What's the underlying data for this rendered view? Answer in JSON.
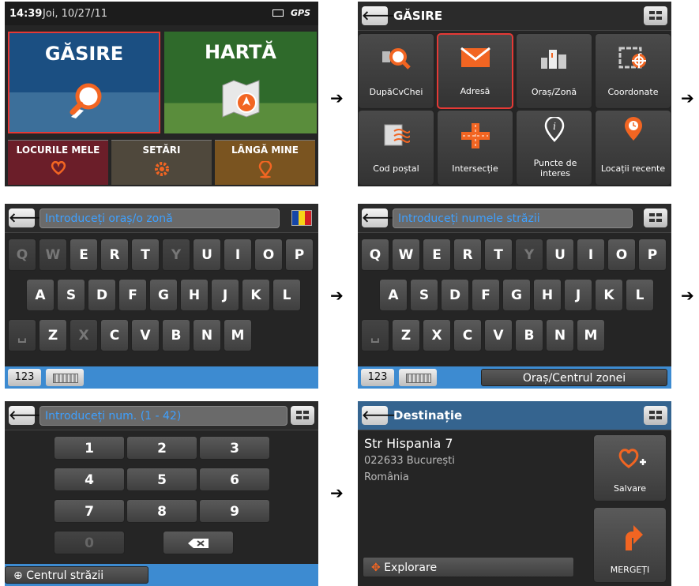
{
  "panel1": {
    "time": "14:39",
    "date": "Joi, 10/27/11",
    "gps": "GPS",
    "find_label": "GĂSIRE",
    "map_label": "HARTĂ",
    "my_places_label": "LOCURILE MELE",
    "settings_label": "SETĂRI",
    "near_me_label": "LÂNGĂ MINE"
  },
  "panel2": {
    "title": "GĂSIRE",
    "categories": [
      {
        "label": "DupăCvChei",
        "icon": "search-icon"
      },
      {
        "label": "Adresă",
        "icon": "envelope-icon",
        "selected": true
      },
      {
        "label": "Oraș/Zonă",
        "icon": "city-icon"
      },
      {
        "label": "Coordonate",
        "icon": "crosshair-icon"
      },
      {
        "label": "Cod poștal",
        "icon": "postal-icon"
      },
      {
        "label": "Intersecție",
        "icon": "intersection-icon"
      },
      {
        "label": "Puncte de interes",
        "icon": "info-pin-icon"
      },
      {
        "label": "Locații recente",
        "icon": "clock-pin-icon"
      }
    ]
  },
  "panel3": {
    "placeholder": "Introduceți oraș/o zonă",
    "row1": [
      "Q",
      "W",
      "E",
      "R",
      "T",
      "Y",
      "U",
      "I",
      "O",
      "P"
    ],
    "row2": [
      "A",
      "S",
      "D",
      "F",
      "G",
      "H",
      "J",
      "K",
      "L"
    ],
    "row3": [
      "␣",
      "Z",
      "X",
      "C",
      "V",
      "B",
      "N",
      "M"
    ],
    "num_label": "123"
  },
  "panel4": {
    "placeholder": "Introduceți numele străzii",
    "row1": [
      "Q",
      "W",
      "E",
      "R",
      "T",
      "Y",
      "U",
      "I",
      "O",
      "P"
    ],
    "row2": [
      "A",
      "S",
      "D",
      "F",
      "G",
      "H",
      "J",
      "K",
      "L"
    ],
    "row3": [
      "␣",
      "Z",
      "X",
      "C",
      "V",
      "B",
      "N",
      "M"
    ],
    "num_label": "123",
    "city_center_label": "Oraș/Centrul zonei"
  },
  "panel5": {
    "placeholder": "Introduceți num. (1 - 42)",
    "keys": [
      "1",
      "2",
      "3",
      "4",
      "5",
      "6",
      "7",
      "8",
      "9",
      "0"
    ],
    "street_center_label": "Centrul străzii"
  },
  "panel6": {
    "title": "Destinație",
    "street": "Str Hispania 7",
    "postal_city": "022633 București",
    "country": "România",
    "save_label": "Salvare",
    "go_label": "MERGEȚI",
    "explore_label": "Explorare"
  },
  "colors": {
    "accent_blue": "#3d8bd1",
    "select_red": "#e53935",
    "icon_orange": "#f26522"
  }
}
